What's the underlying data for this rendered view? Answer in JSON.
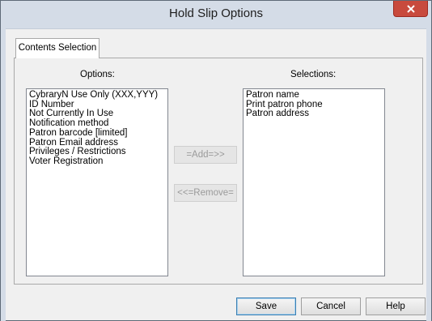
{
  "window": {
    "title": "Hold Slip Options",
    "close_symbol": "✕"
  },
  "tabs": [
    {
      "label": "Contents Selection",
      "active": true
    }
  ],
  "options": {
    "label": "Options:",
    "items": [
      "CybraryN Use Only (XXX,YYY)",
      "ID Number",
      "Not Currently In Use",
      "Notification method",
      "Patron barcode [limited]",
      "Patron Email address",
      "Privileges / Restrictions",
      "Voter Registration"
    ]
  },
  "selections": {
    "label": "Selections:",
    "items": [
      "Patron name",
      "Print patron phone",
      "Patron address"
    ]
  },
  "transfer": {
    "add_label": "=Add=>>",
    "remove_label": "<<=Remove="
  },
  "footer": {
    "save_label": "Save",
    "cancel_label": "Cancel",
    "help_label": "Help"
  },
  "colors": {
    "titlebar": "#d4dce7",
    "close": "#c84a3d",
    "disabled_text": "#9a9a9a"
  }
}
